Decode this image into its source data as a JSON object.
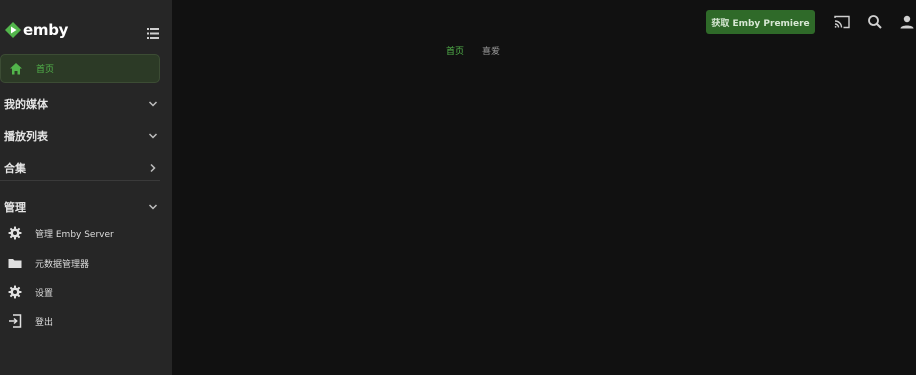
{
  "brand": {
    "name": "emby"
  },
  "sidebar": {
    "home_label": "首页",
    "sections": {
      "media": "我的媒体",
      "playlists": "播放列表",
      "collections": "合集",
      "manage": "管理"
    },
    "manage_items": [
      {
        "label": "管理 Emby Server",
        "icon": "gear-icon"
      },
      {
        "label": "元数据管理器",
        "icon": "folder-icon"
      },
      {
        "label": "设置",
        "icon": "gear-icon"
      },
      {
        "label": "登出",
        "icon": "sign-out-icon"
      }
    ]
  },
  "header": {
    "premiere_label": "获取 Emby Premiere",
    "icons": [
      "cast-icon",
      "search-icon",
      "user-icon"
    ]
  },
  "tabs": [
    {
      "label": "首页",
      "active": true
    },
    {
      "label": "喜爱",
      "active": false
    }
  ],
  "colors": {
    "accent": "#52b54b",
    "sidebar_bg": "#262626",
    "main_bg": "#111111",
    "button_bg": "#2f6a29"
  }
}
